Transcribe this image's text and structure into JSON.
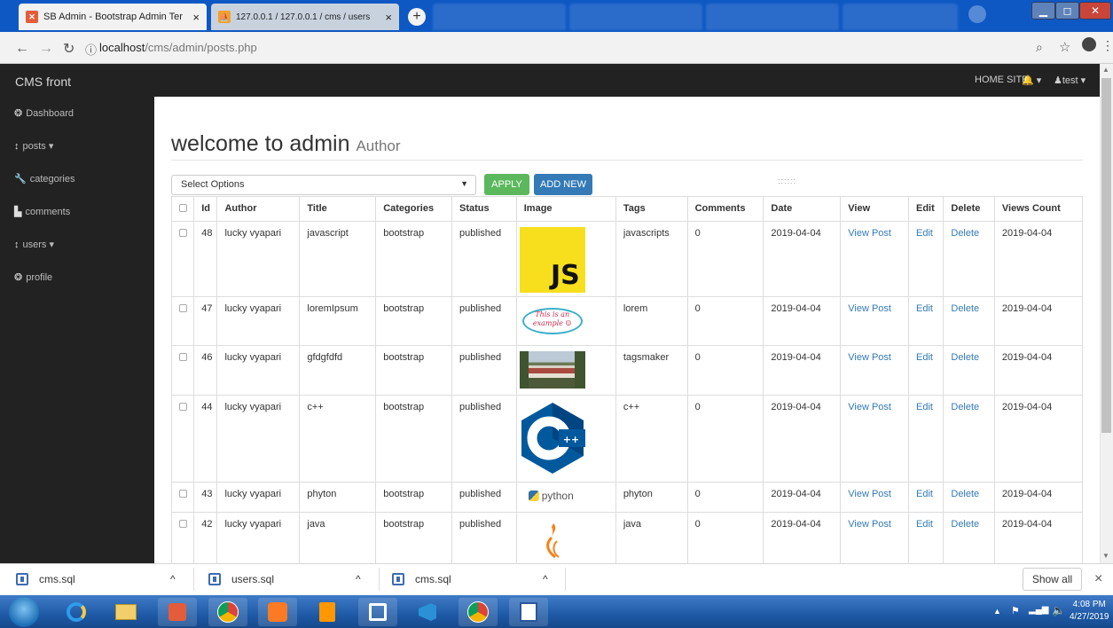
{
  "browser": {
    "tabs": [
      {
        "title": "SB Admin - Bootstrap Admin Ter",
        "close": "×"
      },
      {
        "title": "127.0.0.1 / 127.0.0.1 / cms / users",
        "close": "×"
      }
    ],
    "new_tab": "+",
    "url_host": "localhost",
    "url_path": "/cms/admin/posts.php",
    "info_icon": "ⓘ"
  },
  "navbar": {
    "brand": "CMS front",
    "home_site": "HOME SITE",
    "user": "test"
  },
  "sidebar": {
    "items": [
      {
        "label": "Dashboard",
        "caret": ""
      },
      {
        "label": "posts",
        "caret": "▾"
      },
      {
        "label": "categories",
        "caret": ""
      },
      {
        "label": "comments",
        "caret": ""
      },
      {
        "label": "users",
        "caret": "▾"
      },
      {
        "label": "profile",
        "caret": ""
      }
    ]
  },
  "page": {
    "title": "welcome to admin",
    "subtitle": "Author"
  },
  "toolbar": {
    "select_value": "Select Options",
    "apply_label": "APPLY",
    "add_new_label": "ADD NEW",
    "dots": "::::::"
  },
  "table": {
    "headers": [
      "Id",
      "Author",
      "Title",
      "Categories",
      "Status",
      "Image",
      "Tags",
      "Comments",
      "Date",
      "View",
      "Edit",
      "Delete",
      "Views Count"
    ],
    "rows": [
      {
        "id": "48",
        "author": "lucky vyapari",
        "title": "javascript",
        "category": "bootstrap",
        "status": "published",
        "image": "js-logo",
        "tags": "javascripts",
        "comments": "0",
        "date": "2019-04-04",
        "view": "View Post",
        "edit": "Edit",
        "delete": "Delete",
        "views": "2019-04-04"
      },
      {
        "id": "47",
        "author": "lucky vyapari",
        "title": "loremIpsum",
        "category": "bootstrap",
        "status": "published",
        "image": "example-sketch",
        "tags": "lorem",
        "comments": "0",
        "date": "2019-04-04",
        "view": "View Post",
        "edit": "Edit",
        "delete": "Delete",
        "views": "2019-04-04"
      },
      {
        "id": "46",
        "author": "lucky vyapari",
        "title": "gfdgfdfd",
        "category": "bootstrap",
        "status": "published",
        "image": "building-photo",
        "tags": "tagsmaker",
        "comments": "0",
        "date": "2019-04-04",
        "view": "View Post",
        "edit": "Edit",
        "delete": "Delete",
        "views": "2019-04-04"
      },
      {
        "id": "44",
        "author": "lucky vyapari",
        "title": "c++",
        "category": "bootstrap",
        "status": "published",
        "image": "cpp-logo",
        "tags": "c++",
        "comments": "0",
        "date": "2019-04-04",
        "view": "View Post",
        "edit": "Edit",
        "delete": "Delete",
        "views": "2019-04-04"
      },
      {
        "id": "43",
        "author": "lucky vyapari",
        "title": "phyton",
        "category": "bootstrap",
        "status": "published",
        "image": "python-logo",
        "tags": "phyton",
        "comments": "0",
        "date": "2019-04-04",
        "view": "View Post",
        "edit": "Edit",
        "delete": "Delete",
        "views": "2019-04-04"
      },
      {
        "id": "42",
        "author": "lucky vyapari",
        "title": "java",
        "category": "bootstrap",
        "status": "published",
        "image": "java-logo",
        "tags": "java",
        "comments": "0",
        "date": "2019-04-04",
        "view": "View Post",
        "edit": "Edit",
        "delete": "Delete",
        "views": "2019-04-04"
      }
    ],
    "image_text": {
      "js": "JS",
      "sketch_line1": "This is an",
      "sketch_line2": "example ☺",
      "cpp": "++",
      "python": "python"
    }
  },
  "downloads": {
    "items": [
      "cms.sql",
      "users.sql",
      "cms.sql"
    ],
    "chevron": "^",
    "show_all": "Show all",
    "close": "×"
  },
  "taskbar": {
    "time": "4:08 PM",
    "date": "4/27/2019"
  }
}
